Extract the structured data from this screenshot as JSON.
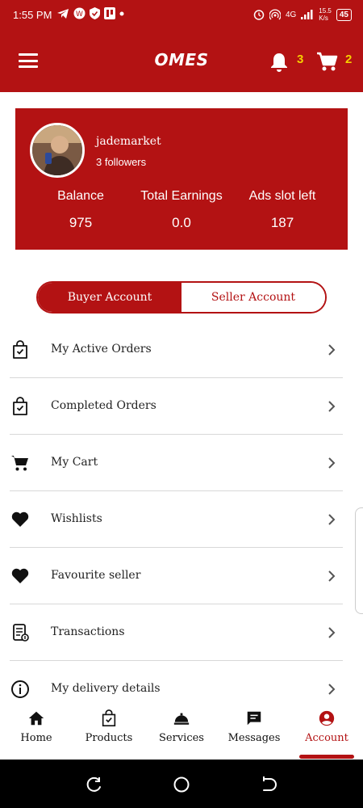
{
  "status_bar": {
    "time": "1:55 PM",
    "network": "4G",
    "speed_value": "15.5",
    "speed_unit": "K/s",
    "battery": "45"
  },
  "app_bar": {
    "title": "OMES",
    "notification_count": "3",
    "cart_count": "2"
  },
  "profile": {
    "username": "jademarket",
    "followers": "3 followers",
    "stats": [
      {
        "label": "Balance",
        "value": "975"
      },
      {
        "label": "Total Earnings",
        "value": "0.0"
      },
      {
        "label": "Ads slot left",
        "value": "187"
      }
    ]
  },
  "account_toggle": {
    "buyer": "Buyer Account",
    "seller": "Seller Account",
    "selected": "buyer"
  },
  "menu": [
    {
      "label": "My Active Orders",
      "icon": "shopping-bag-check-icon"
    },
    {
      "label": "Completed Orders",
      "icon": "shopping-bag-check-icon"
    },
    {
      "label": "My Cart",
      "icon": "cart-icon"
    },
    {
      "label": "Wishlists",
      "icon": "heart-icon"
    },
    {
      "label": "Favourite seller",
      "icon": "heart-icon"
    },
    {
      "label": "Transactions",
      "icon": "receipt-icon"
    },
    {
      "label": "My delivery details",
      "icon": "info-icon"
    }
  ],
  "bottom_nav": [
    {
      "label": "Home",
      "icon": "home-icon"
    },
    {
      "label": "Products",
      "icon": "shopping-bag-icon"
    },
    {
      "label": "Services",
      "icon": "service-bell-icon"
    },
    {
      "label": "Messages",
      "icon": "message-icon"
    },
    {
      "label": "Account",
      "icon": "account-circle-icon",
      "active": true
    }
  ],
  "colors": {
    "brand": "#b31213",
    "badge": "#f5d000"
  }
}
